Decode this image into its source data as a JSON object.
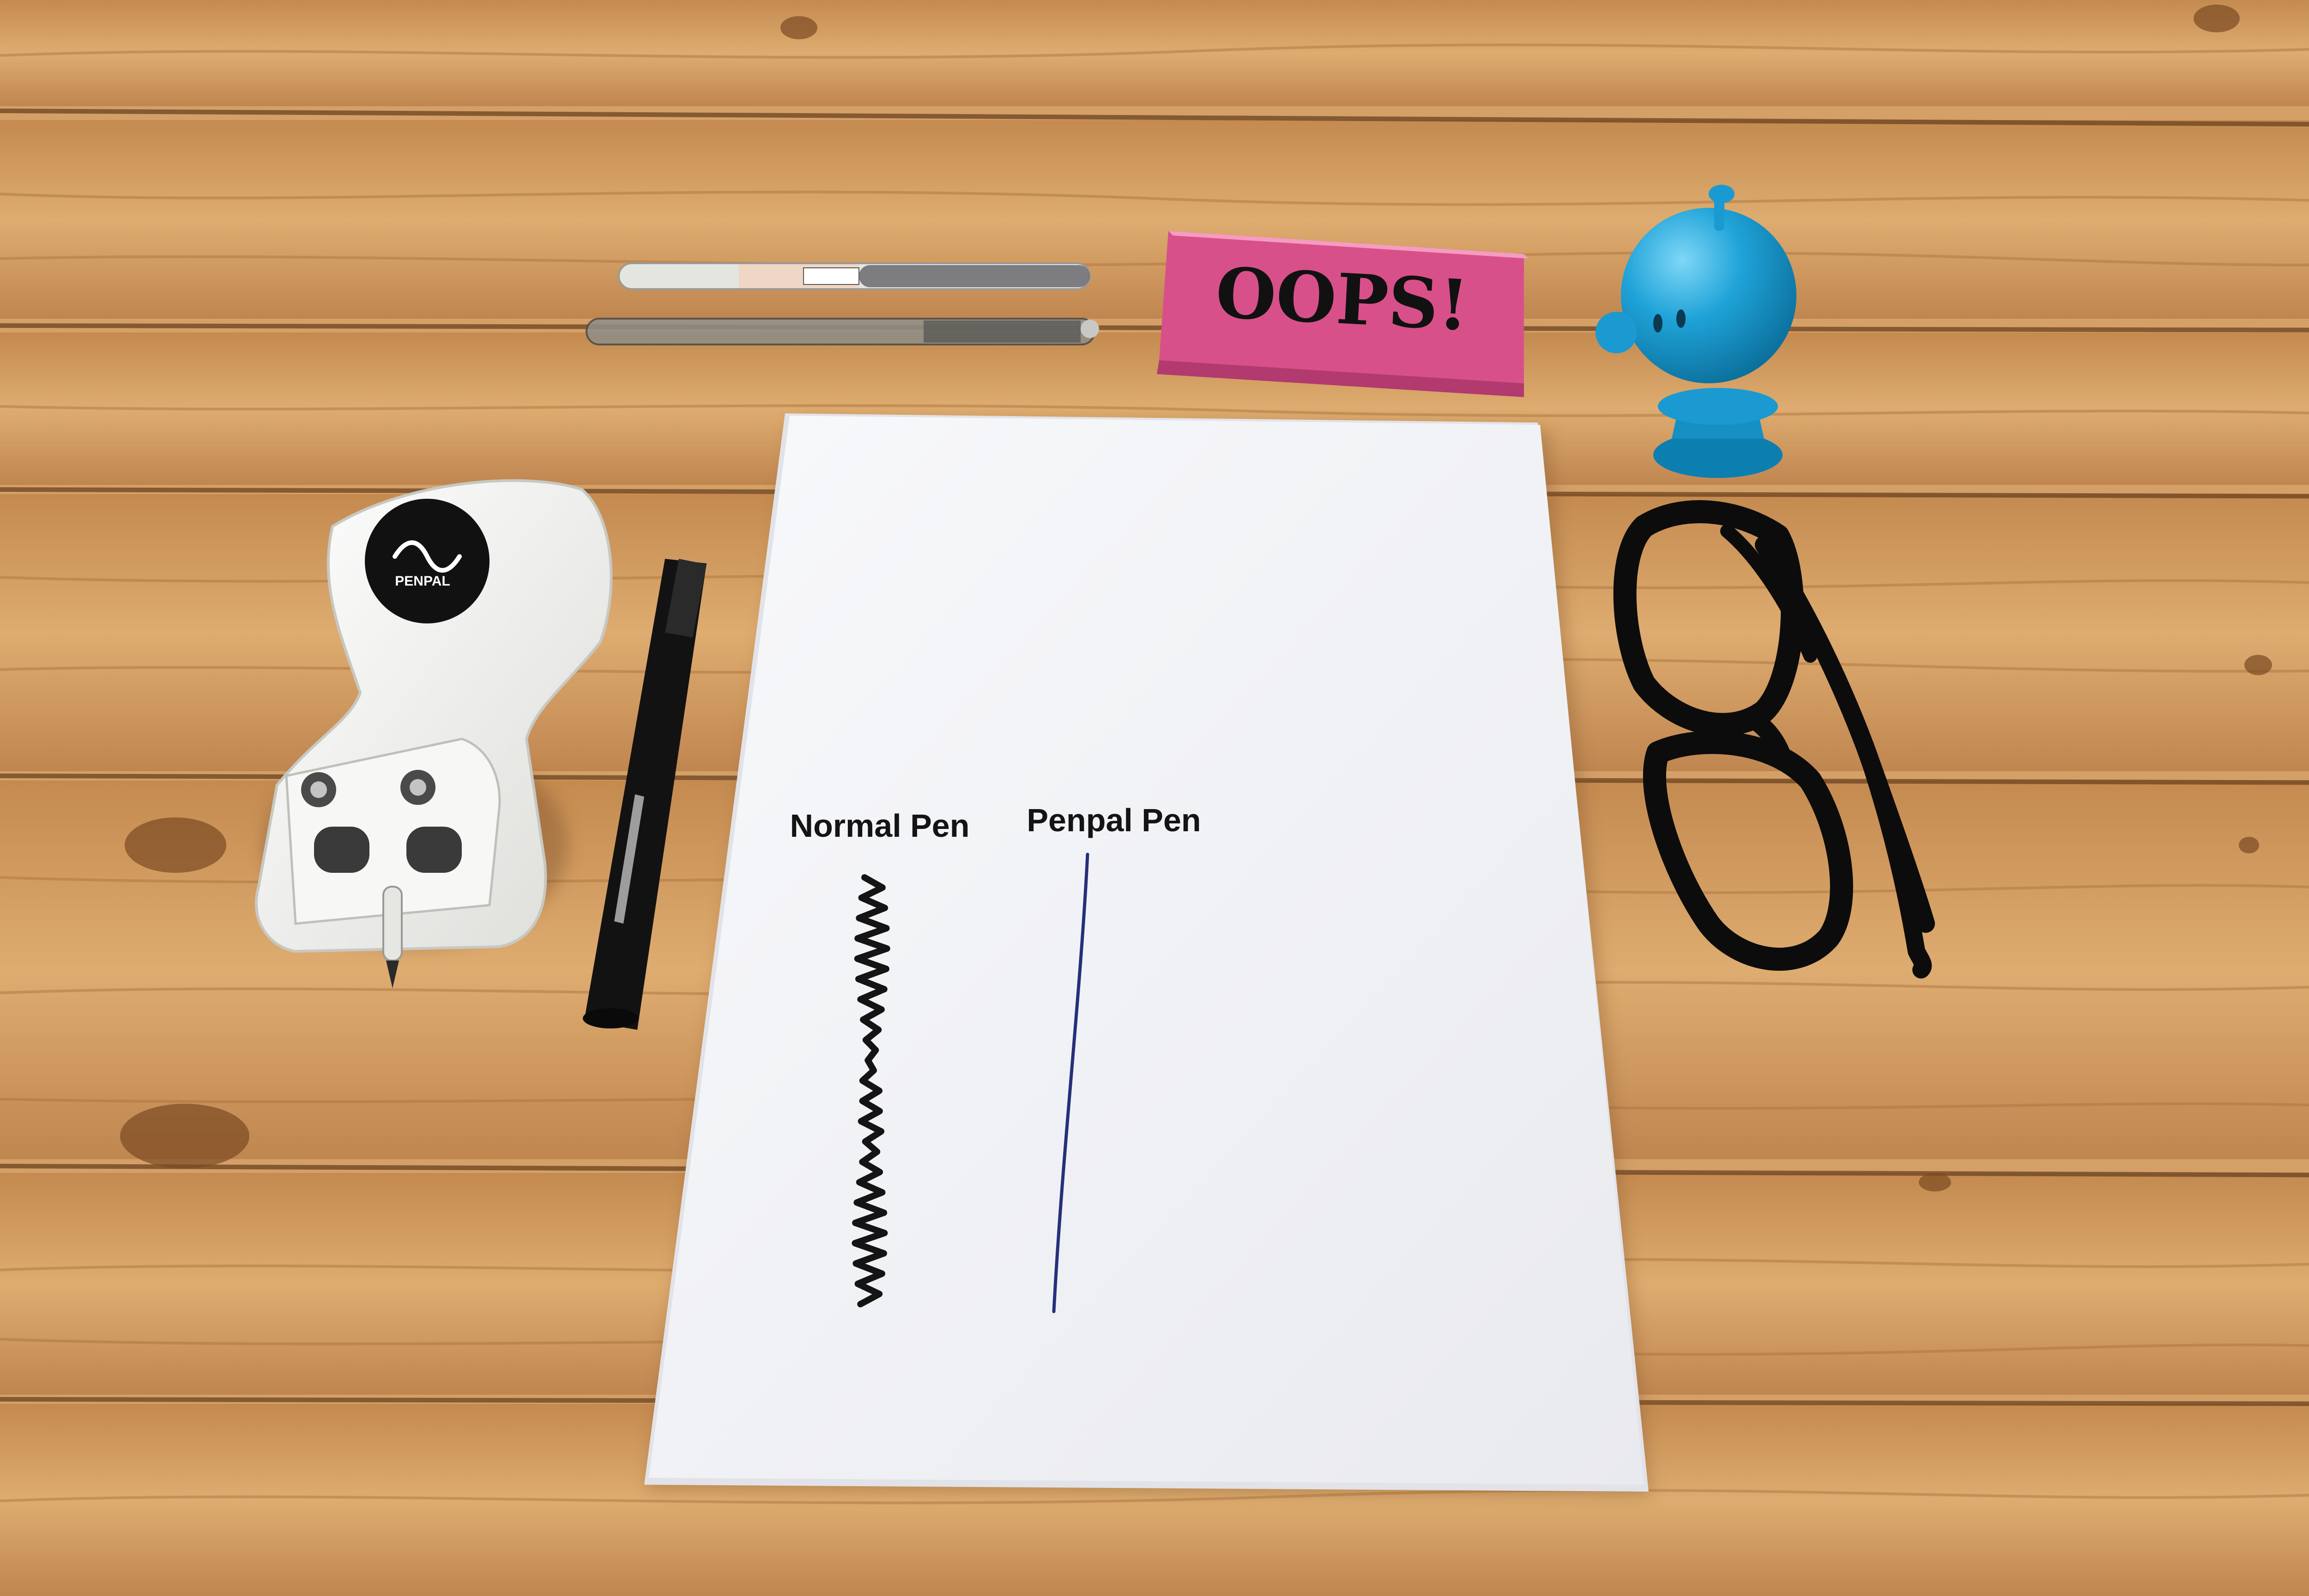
{
  "eraser": {
    "text": "OOPS!"
  },
  "device": {
    "logo_text": "PENPAL"
  },
  "paper": {
    "label_left": "Normal Pen",
    "label_right": "Penpal Pen"
  },
  "colors": {
    "wood_light": "#d8a56c",
    "wood_mid": "#c38a52",
    "wood_dark": "#8a5a30",
    "paper": "#f4f5f8",
    "eraser_pink": "#f26aa0",
    "toy_blue": "#1fa3d8",
    "ink_black": "#141414",
    "ink_blue": "#25307a",
    "device_white": "#f1f1ef"
  }
}
